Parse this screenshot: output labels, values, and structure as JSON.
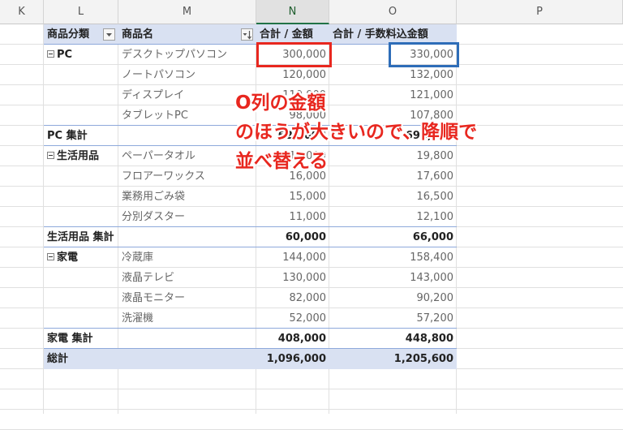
{
  "columns": [
    "K",
    "L",
    "M",
    "N",
    "O",
    "P"
  ],
  "selected_column": "N",
  "header": {
    "category": "商品分類",
    "product": "商品名",
    "sum_amount": "合計 / 金額",
    "sum_fee": "合計 / 手数料込金額"
  },
  "groups": [
    {
      "name": "PC",
      "items": [
        {
          "product": "デスクトップパソコン",
          "amount": "300,000",
          "fee": "330,000"
        },
        {
          "product": "ノートパソコン",
          "amount": "120,000",
          "fee": "132,000"
        },
        {
          "product": "ディスプレイ",
          "amount": "110,000",
          "fee": "121,000"
        },
        {
          "product": "タブレットPC",
          "amount": "98,000",
          "fee": "107,800"
        }
      ],
      "subtotal_label": "PC 集計",
      "subtotal_amount": "628,000",
      "subtotal_fee": "690,800"
    },
    {
      "name": "生活用品",
      "items": [
        {
          "product": "ペーパータオル",
          "amount": "18,000",
          "fee": "19,800"
        },
        {
          "product": "フロアーワックス",
          "amount": "16,000",
          "fee": "17,600"
        },
        {
          "product": "業務用ごみ袋",
          "amount": "15,000",
          "fee": "16,500"
        },
        {
          "product": "分別ダスター",
          "amount": "11,000",
          "fee": "12,100"
        }
      ],
      "subtotal_label": "生活用品 集計",
      "subtotal_amount": "60,000",
      "subtotal_fee": "66,000"
    },
    {
      "name": "家電",
      "items": [
        {
          "product": "冷蔵庫",
          "amount": "144,000",
          "fee": "158,400"
        },
        {
          "product": "液晶テレビ",
          "amount": "130,000",
          "fee": "143,000"
        },
        {
          "product": "液晶モニター",
          "amount": "82,000",
          "fee": "90,200"
        },
        {
          "product": "洗濯機",
          "amount": "52,000",
          "fee": "57,200"
        }
      ],
      "subtotal_label": "家電 集計",
      "subtotal_amount": "408,000",
      "subtotal_fee": "448,800"
    }
  ],
  "grand_total": {
    "label": "総計",
    "amount": "1,096,000",
    "fee": "1,205,600"
  },
  "annotation": {
    "line1": "O列の金額",
    "line2": "のほうが大きいので、降順で",
    "line3": "並べ替える"
  },
  "colors": {
    "highlight_red": "#e8271f",
    "highlight_blue": "#2e6db8",
    "header_band": "#d9e1f2",
    "border_blue": "#8ea9db"
  },
  "icons": {
    "category_filter": "dropdown-arrow-icon",
    "product_filter": "sort-descending-filter-icon",
    "group_toggle": "collapse-minus-icon"
  }
}
